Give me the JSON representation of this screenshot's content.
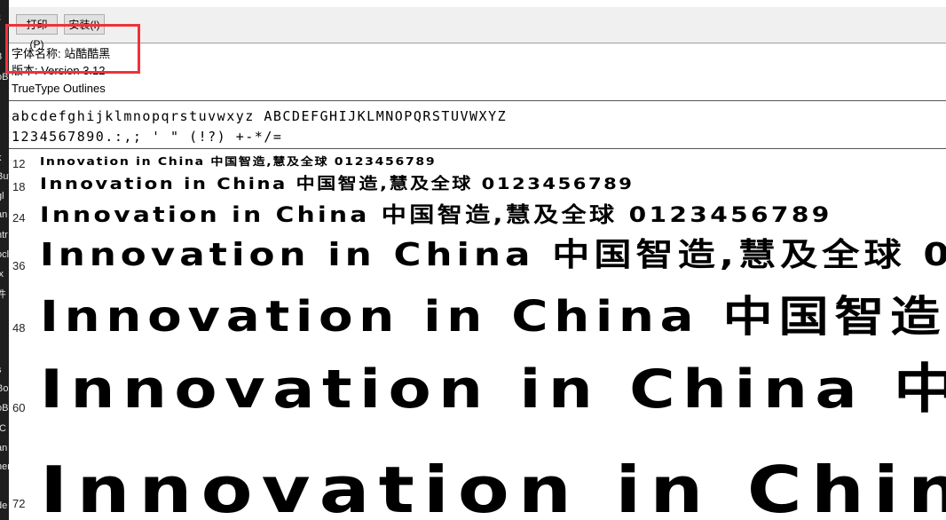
{
  "window": {
    "toolbar": {
      "print_label": "打印(P)",
      "install_label": "安装(I)"
    },
    "font_info": {
      "name_line": "字体名称: 站酷酷黑",
      "version_line": "版本: Version 3.12",
      "outline_line": "TrueType Outlines"
    },
    "character_set": {
      "letters": "abcdefghijklmnopqrstuvwxyz ABCDEFGHIJKLMNOPQRSTUVWXYZ",
      "digits_symbols": "1234567890.:,; ' \" (!?) +-*/="
    },
    "sample_text": "Innovation in China 中国智造,慧及全球 0123456789",
    "sizes": [
      {
        "label": "12"
      },
      {
        "label": "18"
      },
      {
        "label": "24"
      },
      {
        "label": "36"
      },
      {
        "label": "48"
      },
      {
        "label": "60"
      },
      {
        "label": "72"
      }
    ]
  },
  "left_strip_fragments": [
    "ε",
    "3",
    "oB",
    "k",
    "But",
    "gl",
    "an",
    "ntr",
    "ocl",
    "ix",
    "件",
    "s",
    "Bo",
    "oB",
    "tC",
    "an",
    "ner",
    "de"
  ],
  "highlight_color": "#f0323a"
}
